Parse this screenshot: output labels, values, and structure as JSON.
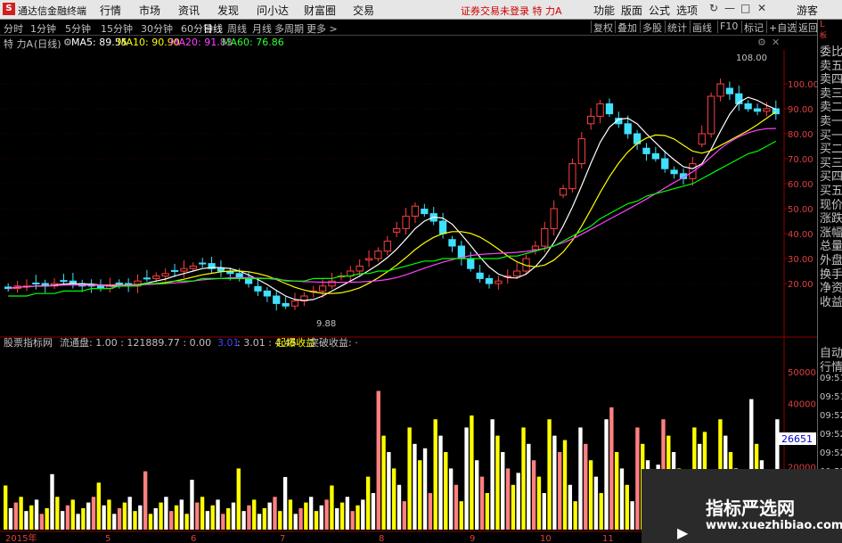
{
  "menubar": {
    "logo": "S",
    "app_title": "通达信金融终端",
    "menus": [
      "行情",
      "市场",
      "资讯",
      "发现",
      "问小达",
      "财富圈",
      "交易"
    ],
    "notice": "证券交易未登录  特 力A",
    "right_menus": [
      "功能",
      "版面",
      "公式",
      "选项"
    ],
    "guest": "游客",
    "window_controls": [
      "↻",
      "—",
      "□",
      "✕"
    ]
  },
  "toolbar": {
    "periods": [
      "分时",
      "1分钟",
      "5分钟",
      "15分钟",
      "30分钟",
      "60分钟",
      "日线",
      "周线",
      "月线",
      "多周期",
      "更多 >"
    ],
    "active_period": "日线",
    "right_buttons": [
      "复权",
      "叠加",
      "多股",
      "统计",
      "画线",
      "F10",
      "标记",
      "+自选",
      "返回"
    ]
  },
  "legend": {
    "stock": "特 力A",
    "period": "(日线)",
    "ma5": "MA5: 89.55",
    "ma10": "MA10: 90.90",
    "ma20": "MA20: 91.83",
    "ma60": "MA60: 76.86",
    "colors": {
      "ma5": "#ffffff",
      "ma10": "#ffff00",
      "ma20": "#ff44ff",
      "ma60": "#00ff00"
    }
  },
  "chart_data": [
    {
      "type": "candlestick",
      "title": "特 力A (日线)",
      "ylim": [
        0,
        110
      ],
      "yticks": [
        "100.00",
        "90.00",
        "80.00",
        "70.00",
        "60.00",
        "50.00",
        "40.00",
        "30.00",
        "20.00"
      ],
      "annotations": {
        "high": "108.00",
        "low": "9.88"
      },
      "close": [
        18,
        19,
        19,
        20,
        19,
        20,
        21,
        20,
        19,
        19,
        18,
        19,
        20,
        19,
        21,
        22,
        23,
        24,
        25,
        26,
        27,
        28,
        26,
        25,
        24,
        22,
        20,
        17,
        15,
        12,
        11,
        13,
        15,
        17,
        19,
        21,
        23,
        25,
        27,
        30,
        33,
        37,
        42,
        47,
        51,
        48,
        45,
        40,
        35,
        30,
        26,
        22,
        20,
        21,
        23,
        25,
        30,
        35,
        42,
        50,
        58,
        68,
        78,
        87,
        92,
        88,
        84,
        80,
        76,
        72,
        70,
        66,
        64,
        62,
        68,
        80,
        95,
        100,
        96,
        92,
        90,
        89,
        90,
        88
      ],
      "ma60": [
        15,
        15,
        15,
        16,
        16,
        16,
        17,
        17,
        17,
        18,
        18,
        18,
        19,
        19,
        19,
        20,
        20,
        20,
        21,
        21,
        21,
        22,
        22,
        22,
        22,
        22,
        22,
        22,
        22,
        22,
        21,
        21,
        21,
        22,
        22,
        22,
        23,
        23,
        24,
        24,
        25,
        25,
        26,
        27,
        28,
        29,
        29,
        30,
        30,
        30,
        30,
        30,
        30,
        30,
        31,
        31,
        32,
        33,
        34,
        35,
        37,
        39,
        41,
        43,
        46,
        48,
        50,
        52,
        53,
        55,
        56,
        57,
        58,
        59,
        60,
        62,
        64,
        66,
        68,
        70,
        72,
        73,
        75,
        77
      ]
    },
    {
      "type": "bar",
      "title": "股票指标网",
      "ylim": [
        0,
        56000
      ],
      "yticks": [
        "50000",
        "40000",
        "30000",
        "20000"
      ],
      "current_value_tag": "26651"
    }
  ],
  "indicator_legend": {
    "name": "股票指标网",
    "flow": "流通盘: 1.00 : 121889.77 : 0.00",
    "v1": "3.01",
    "v2": ": 3.01 : 4.45",
    "breakout_gain": "起爆收益",
    "breakthrough": "· 突破收益: ·"
  },
  "xaxis_labels": [
    "2015年",
    "5",
    "6",
    "7",
    "8",
    "9",
    "10",
    "11"
  ],
  "side_panel": {
    "top": [
      "L",
      "板"
    ],
    "items": [
      "委比",
      "卖五",
      "卖四",
      "卖三",
      "卖二",
      "卖一",
      "买一",
      "买二",
      "买三",
      "买四",
      "买五",
      "现价",
      "涨跌",
      "涨幅",
      "总量",
      "外盘",
      "换手",
      "净资",
      "收益"
    ],
    "lower": [
      "自动",
      "行情"
    ],
    "times": [
      "09:51",
      "09:51",
      "09:52",
      "09:52",
      "09:52",
      "09:52",
      "09:52"
    ]
  },
  "watermark": {
    "cn": "指标严选网",
    "url": "www.xuezhibiao.com"
  }
}
